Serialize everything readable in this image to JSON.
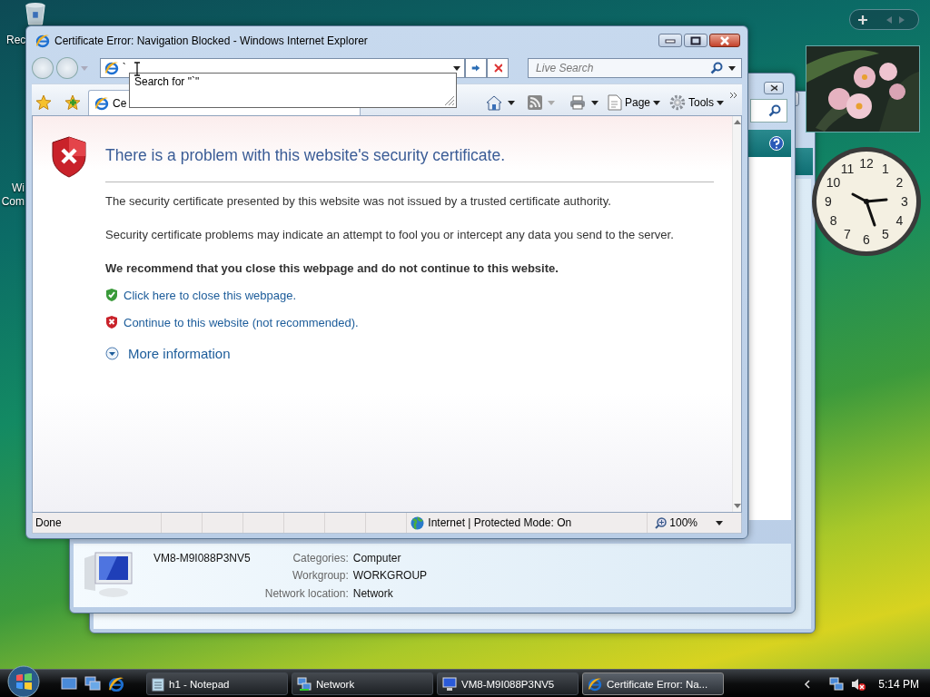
{
  "desktop": {
    "icons": [
      {
        "label": "Rec",
        "kind": "recycle"
      },
      {
        "label": "Wi Com",
        "kind": "computer"
      }
    ]
  },
  "gadgets": {
    "clock": {
      "numerals": [
        "12",
        "11",
        "1",
        "10",
        "2",
        "9",
        "3",
        "8",
        "4",
        "7",
        "5",
        "6"
      ]
    }
  },
  "network_window": {
    "details": {
      "name": "VM8-M9I088P3NV5",
      "fields": [
        {
          "label": "Categories:",
          "value": "Computer"
        },
        {
          "label": "Workgroup:",
          "value": "WORKGROUP"
        },
        {
          "label": "Network location:",
          "value": "Network"
        }
      ]
    }
  },
  "browser": {
    "title": "Certificate Error: Navigation Blocked - Windows Internet Explorer",
    "address": {
      "value": "`"
    },
    "autocomplete": {
      "text": "Search for \"`\""
    },
    "search": {
      "placeholder": "Live Search"
    },
    "tab": {
      "label": "Ce"
    },
    "commands": [
      {
        "label": "Page",
        "kind": "page"
      },
      {
        "label": "Tools",
        "kind": "tools"
      }
    ],
    "page": {
      "heading": "There is a problem with this website's security certificate.",
      "paragraphs": [
        "The security certificate presented by this website was not issued by a trusted certificate authority.",
        "Security certificate problems may indicate an attempt to fool you or intercept any data you send to the server."
      ],
      "recommendation": "We recommend that you close this webpage and do not continue to this website.",
      "links": [
        {
          "kind": "safe",
          "text": "Click here to close this webpage."
        },
        {
          "kind": "unsafe",
          "text": "Continue to this website (not recommended)."
        }
      ],
      "more_info": "More information"
    },
    "status_bar": {
      "status": "Done",
      "zone": "Internet | Protected Mode: On",
      "zoom": "100%"
    }
  },
  "taskbar": {
    "buttons": [
      {
        "label": "h1 - Notepad",
        "kind": "notepad",
        "selected": false
      },
      {
        "label": "Network",
        "kind": "network",
        "selected": false
      },
      {
        "label": "VM8-M9I088P3NV5",
        "kind": "computer",
        "selected": false
      },
      {
        "label": "Certificate Error: Na...",
        "kind": "browser",
        "selected": true
      }
    ],
    "clock": "5:14 PM"
  }
}
